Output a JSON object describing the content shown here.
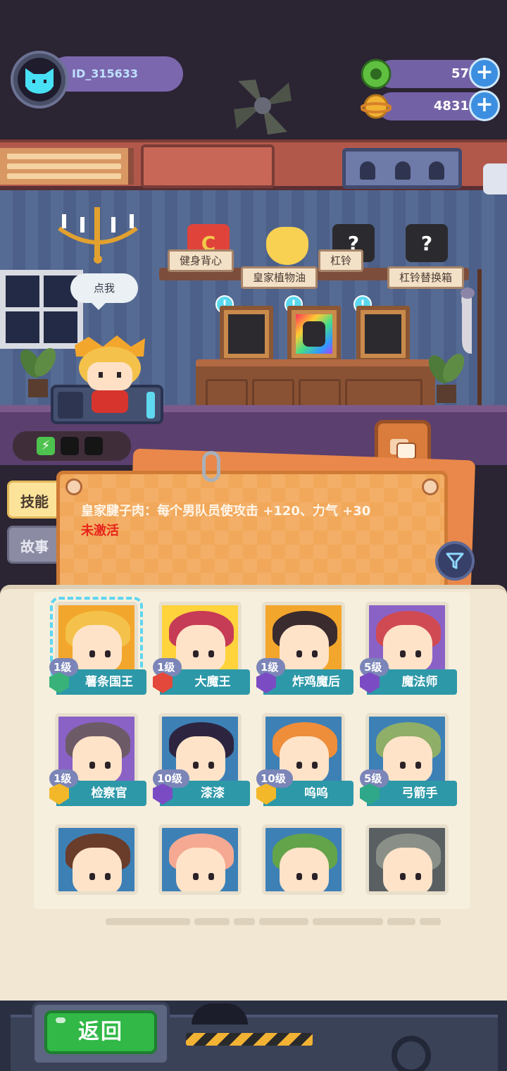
{
  "player": {
    "id": "ID_315633"
  },
  "currencies": [
    {
      "name": "green-gem",
      "value": "57",
      "color": "#5fbf3f"
    },
    {
      "name": "gold-planet",
      "value": "4831",
      "color": "#f2b233"
    }
  ],
  "scene": {
    "speech_bubble": "点我",
    "shelf_items": [
      {
        "label": "健身背心"
      },
      {
        "label": "皇家植物油"
      },
      {
        "label": "杠铃"
      },
      {
        "label": "杠铃替换箱"
      }
    ],
    "unknown_mark": "?",
    "alert_mark": "!"
  },
  "side_tabs": {
    "skill": "技能",
    "story": "故事"
  },
  "skill_card": {
    "description": "皇家腱子肉：每个男队员使攻击 +120、力气 +30",
    "status": "未激活",
    "status_color": "#e8241c"
  },
  "characters": [
    {
      "name": "薯条国王",
      "level": "1级",
      "badge_color": "#39b27a",
      "hair": "#f4c24a",
      "bg": "#f3a62c",
      "selected": true
    },
    {
      "name": "大魔王",
      "level": "1级",
      "badge_color": "#e3483a",
      "hair": "#c63b55",
      "bg": "#ffd33c"
    },
    {
      "name": "炸鸡魔后",
      "level": "1级",
      "badge_color": "#7b4bc4",
      "hair": "#3a2b2f",
      "bg": "#f3a62c"
    },
    {
      "name": "魔法师",
      "level": "5级",
      "badge_color": "#7b4bc4",
      "hair": "#d04a53",
      "bg": "#8a62c6"
    },
    {
      "name": "检察官",
      "level": "1级",
      "badge_color": "#f3b829",
      "hair": "#6d5a67",
      "bg": "#8a62c6"
    },
    {
      "name": "漆漆",
      "level": "10级",
      "badge_color": "#7b4bc4",
      "hair": "#2d2540",
      "bg": "#3d80b6"
    },
    {
      "name": "呜呜",
      "level": "10级",
      "badge_color": "#f3b829",
      "hair": "#ee8d3a",
      "bg": "#3d80b6"
    },
    {
      "name": "弓箭手",
      "level": "5级",
      "badge_color": "#2ea888",
      "hair": "#8fae67",
      "bg": "#3d80b6"
    },
    {
      "name": "",
      "level": "",
      "badge_color": "#888888",
      "hair": "#6a3c2a",
      "bg": "#3d80b6"
    },
    {
      "name": "",
      "level": "",
      "badge_color": "#888888",
      "hair": "#f5a992",
      "bg": "#3d80b6"
    },
    {
      "name": "",
      "level": "",
      "badge_color": "#888888",
      "hair": "#63a34a",
      "bg": "#3d80b6"
    },
    {
      "name": "",
      "level": "",
      "badge_color": "#888888",
      "hair": "#8a9088",
      "bg": "#5a6062"
    }
  ],
  "footer": {
    "back_label": "返回"
  }
}
